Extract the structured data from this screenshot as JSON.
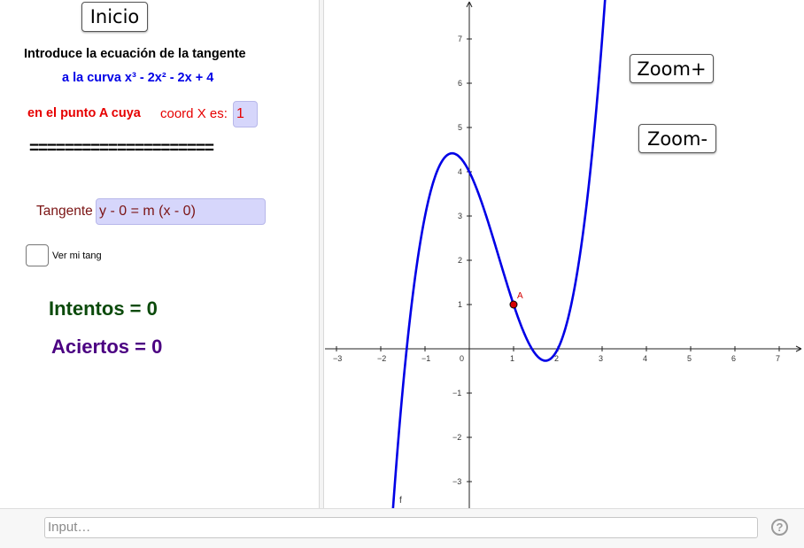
{
  "buttons": {
    "inicio": "Inicio",
    "zoom_in": "Zoom+",
    "zoom_out": "Zoom-"
  },
  "panel": {
    "instruction": "Introduce la ecuación de la tangente",
    "curve": "a la curva x³ - 2x² - 2x + 4",
    "point_prefix": "en el punto A cuya",
    "coord_label": "coord X es:",
    "coord_value": "1",
    "separator": "=====================",
    "tangent_label": "Tangente",
    "tangent_value": "y - 0 = m (x - 0)",
    "checkbox_label": "Ver mi tang",
    "intentos": "Intentos = 0",
    "aciertos": "Aciertos = 0"
  },
  "input_bar": {
    "placeholder": "Input…"
  },
  "help_icon": "question-mark-icon",
  "graph": {
    "function_label": "f",
    "point_label": "A",
    "point": {
      "x": 1,
      "y": 1
    },
    "x_ticks": [
      "−3",
      "−2",
      "−1",
      "0",
      "1",
      "2",
      "3",
      "4",
      "5",
      "6",
      "7"
    ],
    "y_ticks_pos": [
      "1",
      "2",
      "3",
      "4",
      "5",
      "6",
      "7"
    ],
    "y_ticks_neg": [
      "−1",
      "−2",
      "−3"
    ],
    "x_range": [
      -3.3,
      7.5
    ],
    "y_range": [
      -3.6,
      7.9
    ],
    "curve_color": "#0000e6",
    "point_color": "#d40000"
  },
  "colors": {
    "blue": "#0000e6",
    "red": "#e60000",
    "dark_red": "#7b1414",
    "green": "#0b4a0b",
    "purple": "#4b0082"
  }
}
